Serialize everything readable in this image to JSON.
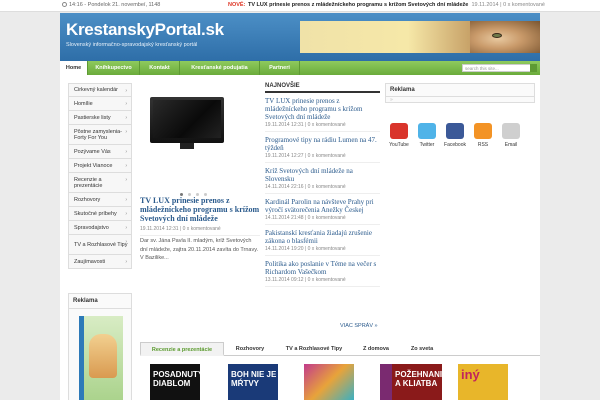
{
  "topbar": {
    "datetime": "14:16 - Pondelok 21. novembeí, 1148",
    "novel_label": "NOVÉ:",
    "ticker_title": "TV LUX prinesie prenos z mládežníckeho programu s krížom Svetových dní mládeže",
    "ticker_date": "19.11.2014",
    "ticker_comments": "0 x komentované"
  },
  "header": {
    "logo": "KrestanskyPortal.sk",
    "slogan": "Slovenský informačno-spravodajský kresťanský portál"
  },
  "nav": {
    "items": [
      "Home",
      "Kníhkupectvo",
      "Kontakt",
      "Kresťanské podujatia",
      "Partneri"
    ],
    "search_placeholder": "search this site..."
  },
  "sidebar": {
    "items": [
      "Cirkevný kalendár",
      "Homílie",
      "Pastierske listy",
      "Pôstne zamyslenia- Forty For You",
      "Pozývame Vás",
      "Projekt Vianoce",
      "Recenzie a prezentácie",
      "Rozhovory",
      "Skutočné príbehy",
      "Spravodajstvo",
      "TV a Rozhlasové Tipy",
      "Zaujímavosti"
    ],
    "promo_title": "Reklama"
  },
  "featured": {
    "title": "TV LUX prinesie prenos z mládežníckeho programu s krížom Svetových dní mládeže",
    "meta": "19.11.2014 12:31  |  0 x komentované",
    "excerpt": "Dar sv. Jána Pavla II. mladým, kríž Svetových dní mládeže, zajtra 20.11.2014 zavíta do Trnavy. V Bazilike..."
  },
  "news": {
    "heading": "NAJNOVŠIE",
    "items": [
      {
        "title": "TV LUX prinesie prenos z mládežníckeho programu s krížom Svetových dní mládeže",
        "meta": "19.11.2014 12:31  |  0 x komentované"
      },
      {
        "title": "Programové tipy na rádiu Lumen na 47. týždeň",
        "meta": "19.11.2014 12:27  |  0 x komentované"
      },
      {
        "title": "Kríž Svetových dní mládeže na Slovensku",
        "meta": "14.11.2014 22:16  |  0 x komentované"
      },
      {
        "title": "Kardinál Parolin na návšteve Prahy pri výročí svätorečenia Anežky Českej",
        "meta": "14.11.2014 21:48  |  0 x komentované"
      },
      {
        "title": "Pakistanskí kresťania žiadajú zrušenie zákona o blasfémii",
        "meta": "14.11.2014 19:20  |  0 x komentované"
      },
      {
        "title": "Politika ako poslanie v Téme na večer s Richardom Vašečkom",
        "meta": "13.11.2014 09:12  |  0 x komentované"
      }
    ],
    "more": "VIAC SPRÁV »"
  },
  "right": {
    "ad_title": "Reklama",
    "ad_dot": "»",
    "social": [
      {
        "label": "YouTube",
        "icon": "youtube-icon",
        "color": "#d9342b"
      },
      {
        "label": "Twitter",
        "icon": "twitter-icon",
        "color": "#4fb3e8"
      },
      {
        "label": "Facebook",
        "icon": "facebook-icon",
        "color": "#3b5998"
      },
      {
        "label": "RSS",
        "icon": "rss-icon",
        "color": "#f39325"
      },
      {
        "label": "Email",
        "icon": "email-icon",
        "color": "#cfcfcf"
      }
    ]
  },
  "tabs": {
    "items": [
      "Recenzie a prezentácie",
      "Rozhovory",
      "TV a Rozhlasové Tipy",
      "Z domova",
      "Zo sveta"
    ]
  },
  "books": [
    {
      "text": "POSADNUTÝ DIABLOM",
      "color": "#111111"
    },
    {
      "text": "BOH NIE JE MŔTVY",
      "color": "#1a3a78"
    },
    {
      "text": "",
      "color": "#c23b8c"
    },
    {
      "text": "",
      "color": "#7a2a70"
    },
    {
      "text": "POŽEHNANIE A KLIATBA",
      "color": "#8a1a1a"
    },
    {
      "text": "iný",
      "color": "#e8b62a"
    }
  ],
  "colors": {
    "accent": "#2e6ea8",
    "nav": "#6aab3b",
    "link": "#2a5a8c"
  }
}
